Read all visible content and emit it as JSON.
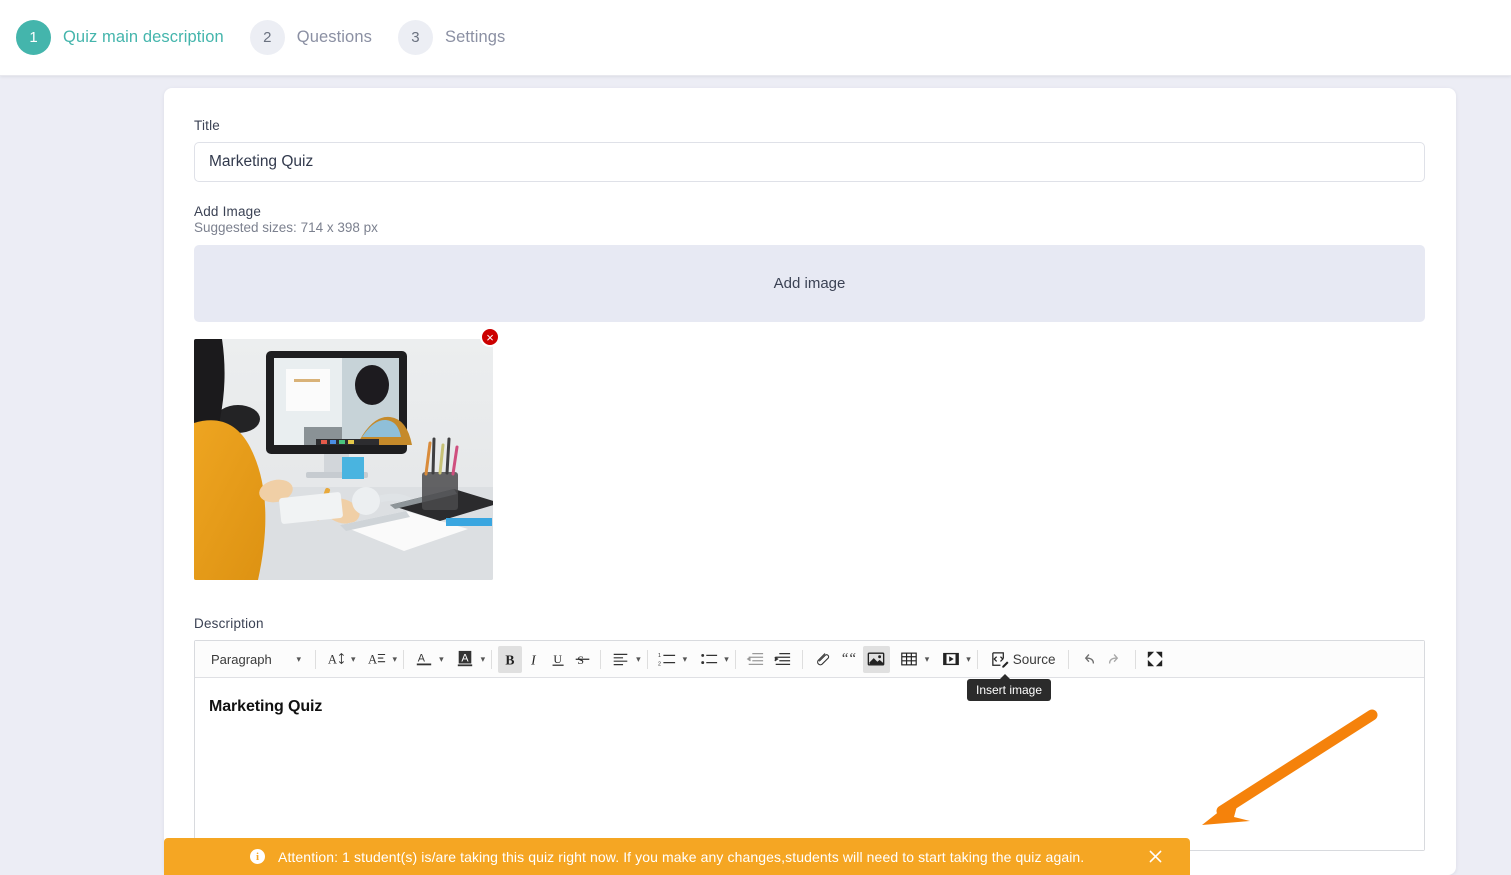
{
  "stepper": {
    "steps": [
      {
        "num": "1",
        "label": "Quiz main description",
        "state": "active"
      },
      {
        "num": "2",
        "label": "Questions",
        "state": "inactive"
      },
      {
        "num": "3",
        "label": "Settings",
        "state": "inactive"
      }
    ]
  },
  "form": {
    "title_label": "Title",
    "title_value": "Marketing Quiz",
    "title_placeholder": "Title",
    "image_label": "Add Image",
    "image_hint": "Suggested sizes: 714 x 398 px",
    "dropzone_label": "Add image",
    "remove_image_label": "×",
    "description_label": "Description",
    "description_body": "Marketing Quiz"
  },
  "toolbar": {
    "paragraph_label": "Paragraph",
    "source_label": "Source",
    "items": [
      "paragraph-style-select",
      "font-size",
      "font-family",
      "font-color",
      "background-color",
      "bold",
      "italic",
      "underline",
      "strikethrough",
      "alignment",
      "numbered-list",
      "bulleted-list",
      "outdent",
      "indent",
      "link",
      "blockquote",
      "insert-image",
      "insert-table",
      "insert-media",
      "source",
      "undo",
      "redo",
      "fullscreen"
    ]
  },
  "tooltip": {
    "text": "Insert image"
  },
  "banner": {
    "text": "Attention: 1 student(s) is/are taking this quiz right now. If you make any changes,students will need to start taking the quiz again.",
    "info_glyph": "i",
    "close_label": "×",
    "color": "#f5a623"
  },
  "annotation": {
    "arrow_color": "#f5820b"
  },
  "colors": {
    "accent": "#44b5ac",
    "page_bg": "#ecedf5",
    "card_bg": "#ffffff",
    "dropzone_bg": "#e7e9f3",
    "remove_btn": "#cc0000"
  }
}
